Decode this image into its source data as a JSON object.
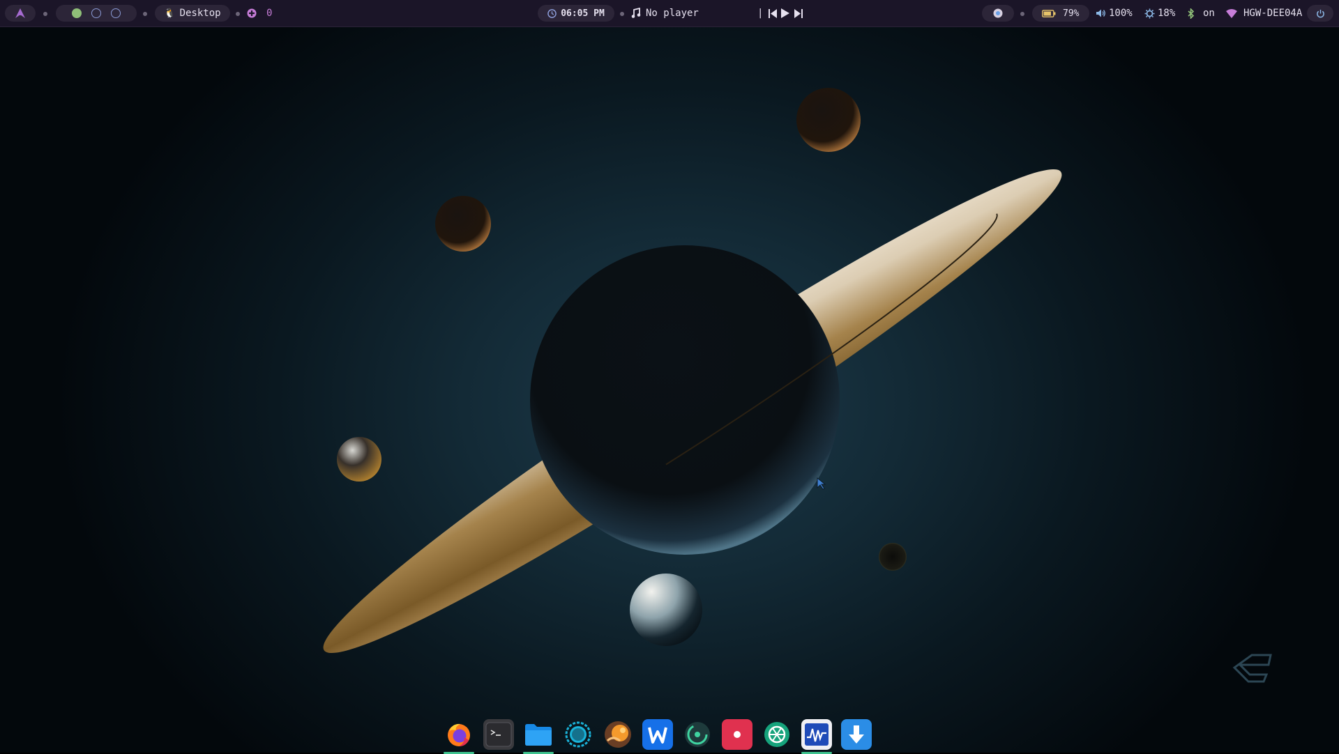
{
  "topbar": {
    "launcher_icon": "arch-logo-icon",
    "workspaces": [
      {
        "state": "active"
      },
      {
        "state": "idle"
      },
      {
        "state": "idle"
      }
    ],
    "active_window": {
      "icon": "penguin-icon",
      "label": "Desktop"
    },
    "notifications": {
      "icon": "notification-icon",
      "count": "0"
    },
    "clock": {
      "icon": "clock-icon",
      "time": "06:05 PM"
    },
    "media": {
      "icon": "music-note-icon",
      "label": "No player"
    },
    "media_controls": {
      "previous": "skip-previous-icon",
      "play": "play-icon",
      "next": "skip-next-icon"
    },
    "tray_icon": "chromium-icon",
    "battery": {
      "icon": "battery-icon",
      "value": "79%"
    },
    "volume": {
      "icon": "volume-icon",
      "value": "100%"
    },
    "brightness": {
      "icon": "brightness-icon",
      "value": "18%"
    },
    "bluetooth": {
      "icon": "bluetooth-icon",
      "value": "on"
    },
    "wifi": {
      "icon": "wifi-icon",
      "ssid": "HGW-DEE04A"
    },
    "power_icon": "power-icon"
  },
  "dock": {
    "apps": [
      {
        "name": "firefox",
        "icon": "firefox-icon",
        "running": true
      },
      {
        "name": "terminal",
        "icon": "terminal-icon",
        "running": false
      },
      {
        "name": "files",
        "icon": "folder-icon",
        "running": true
      },
      {
        "name": "app-ring",
        "icon": "ring-app-icon",
        "running": false
      },
      {
        "name": "app-orange",
        "icon": "orange-app-icon",
        "running": false
      },
      {
        "name": "wps-writer",
        "icon": "writer-icon",
        "running": false
      },
      {
        "name": "app-compass",
        "icon": "compass-app-icon",
        "running": false
      },
      {
        "name": "app-record",
        "icon": "record-app-icon",
        "running": false
      },
      {
        "name": "app-aperture",
        "icon": "aperture-app-icon",
        "running": false
      },
      {
        "name": "system-monitor",
        "icon": "monitor-app-icon",
        "running": true
      },
      {
        "name": "downloader",
        "icon": "download-app-icon",
        "running": false
      }
    ]
  },
  "colors": {
    "bar_bg": "#1b1528",
    "pill_bg": "#2c2538",
    "accent_purple": "#c77dd8",
    "accent_blue": "#8b9bd6",
    "accent_green": "#8fbf78",
    "running_indicator": "#3fc48f"
  }
}
